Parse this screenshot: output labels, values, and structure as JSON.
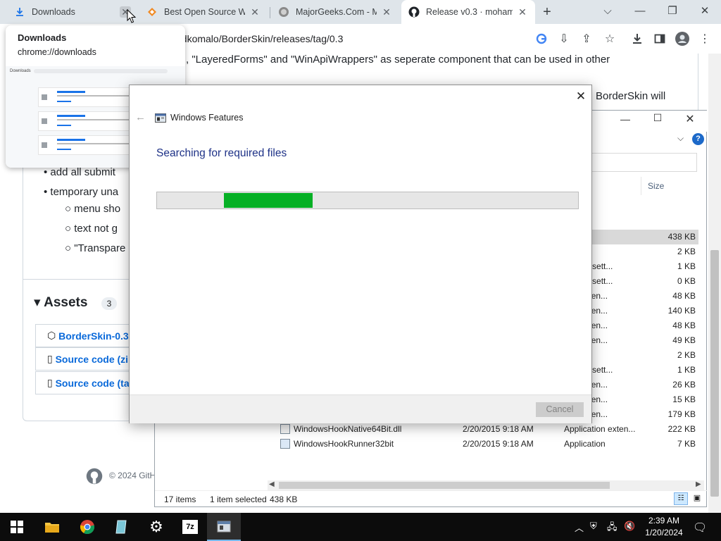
{
  "browser": {
    "tabs": [
      {
        "title": "Downloads",
        "icon": "download-icon"
      },
      {
        "title": "Best Open Source Win",
        "icon": "fossmint-icon"
      },
      {
        "title": "MajorGeeks.Com - Ma",
        "icon": "majorgeeks-icon"
      },
      {
        "title": "Release v0.3 · mohame",
        "icon": "github-icon"
      }
    ],
    "url": "github.com/mohamedkomalo/BorderSkin/releases/tag/0.3",
    "url_visible": "edkomalo/BorderSkin/releases/tag/0.3"
  },
  "hover_card": {
    "title": "Downloads",
    "subtitle": "chrome://downloads",
    "thumb_label": "Downloads"
  },
  "github_page": {
    "line1": ", \"LayeredForms\" and \"WinApiWrappers\" as seperate component that can be used in other",
    "line2_tail": "BorderSkin will",
    "bullets": [
      "add all submit",
      "temporary una"
    ],
    "sub_bullets": [
      "menu sho",
      "text not g",
      "\"Transpare"
    ],
    "assets_heading": "Assets",
    "assets_count": "3",
    "assets": [
      "BorderSkin-0.3.z",
      "Source code (zip",
      "Source code (tar"
    ],
    "footer": "© 2024 GitH"
  },
  "explorer": {
    "col_size": "Size",
    "rows": [
      {
        "name": "",
        "date": "",
        "type": "ler",
        "size": ""
      },
      {
        "name": "",
        "date": "",
        "type": "ler",
        "size": ""
      },
      {
        "name": "",
        "date": "",
        "type": "tion",
        "size": "438 KB",
        "selected": true
      },
      {
        "name": "",
        "date": "",
        "type": "cument",
        "size": "2 KB"
      },
      {
        "name": "",
        "date": "",
        "type": "uration sett...",
        "size": "1 KB"
      },
      {
        "name": "",
        "date": "",
        "type": "uration sett...",
        "size": "0 KB"
      },
      {
        "name": "",
        "date": "",
        "type": "tion exten...",
        "size": "48 KB"
      },
      {
        "name": "",
        "date": "",
        "type": "tion exten...",
        "size": "140 KB"
      },
      {
        "name": "",
        "date": "",
        "type": "tion exten...",
        "size": "48 KB"
      },
      {
        "name": "",
        "date": "",
        "type": "tion exten...",
        "size": "49 KB"
      },
      {
        "name": "",
        "date": "",
        "type": "cument",
        "size": "2 KB"
      },
      {
        "name": "",
        "date": "",
        "type": "uration sett...",
        "size": "1 KB"
      },
      {
        "name": "",
        "date": "",
        "type": "tion exten...",
        "size": "26 KB"
      },
      {
        "name": "",
        "date": "",
        "type": "tion exten...",
        "size": "15 KB"
      },
      {
        "name": "",
        "date": "",
        "type": "tion exten...",
        "size": "179 KB"
      },
      {
        "name": "WindowsHookNative64Bit.dll",
        "date": "2/20/2015 9:18 AM",
        "type": "Application exten...",
        "size": "222 KB"
      },
      {
        "name": "WindowsHookRunner32bit",
        "date": "2/20/2015 9:18 AM",
        "type": "Application",
        "size": "7 KB"
      }
    ],
    "status_items": "17 items",
    "status_selected": "1 item selected",
    "status_size": "438 KB"
  },
  "dialog": {
    "title": "Windows Features",
    "heading": "Searching for required files",
    "progress": 0.21,
    "cancel_label": "Cancel"
  },
  "taskbar": {
    "time": "2:39 AM",
    "date": "1/20/2024"
  }
}
